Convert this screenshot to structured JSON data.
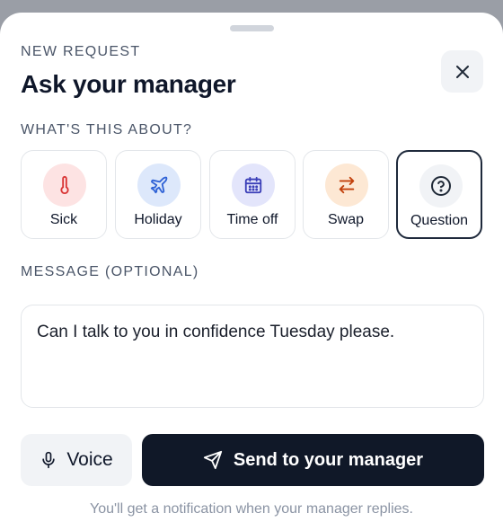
{
  "header": {
    "eyebrow": "NEW REQUEST",
    "title": "Ask your manager",
    "close_icon": "close-icon"
  },
  "category_section": {
    "label": "WHAT'S THIS ABOUT?",
    "selected": "Question",
    "items": [
      {
        "label": "Sick",
        "icon": "thermometer-icon",
        "bg": "#fde3e3",
        "fg": "#d93636"
      },
      {
        "label": "Holiday",
        "icon": "plane-icon",
        "bg": "#dde8fb",
        "fg": "#2f62d6"
      },
      {
        "label": "Time off",
        "icon": "calendar-icon",
        "bg": "#e3e5fb",
        "fg": "#3b3fb8"
      },
      {
        "label": "Swap",
        "icon": "swap-arrows-icon",
        "bg": "#fde8d4",
        "fg": "#c2410c"
      },
      {
        "label": "Question",
        "icon": "question-circle-icon",
        "bg": "#f1f3f6",
        "fg": "#1f2937"
      }
    ]
  },
  "message": {
    "label": "MESSAGE (OPTIONAL)",
    "value": "Can I talk to you in confidence Tuesday please."
  },
  "actions": {
    "voice_label": "Voice",
    "voice_icon": "microphone-icon",
    "send_label": "Send to your manager",
    "send_icon": "send-icon"
  },
  "footer": {
    "note": "You'll get a notification when your manager replies."
  },
  "colors": {
    "primary": "#101828",
    "backdrop": "#9a9ea6"
  }
}
